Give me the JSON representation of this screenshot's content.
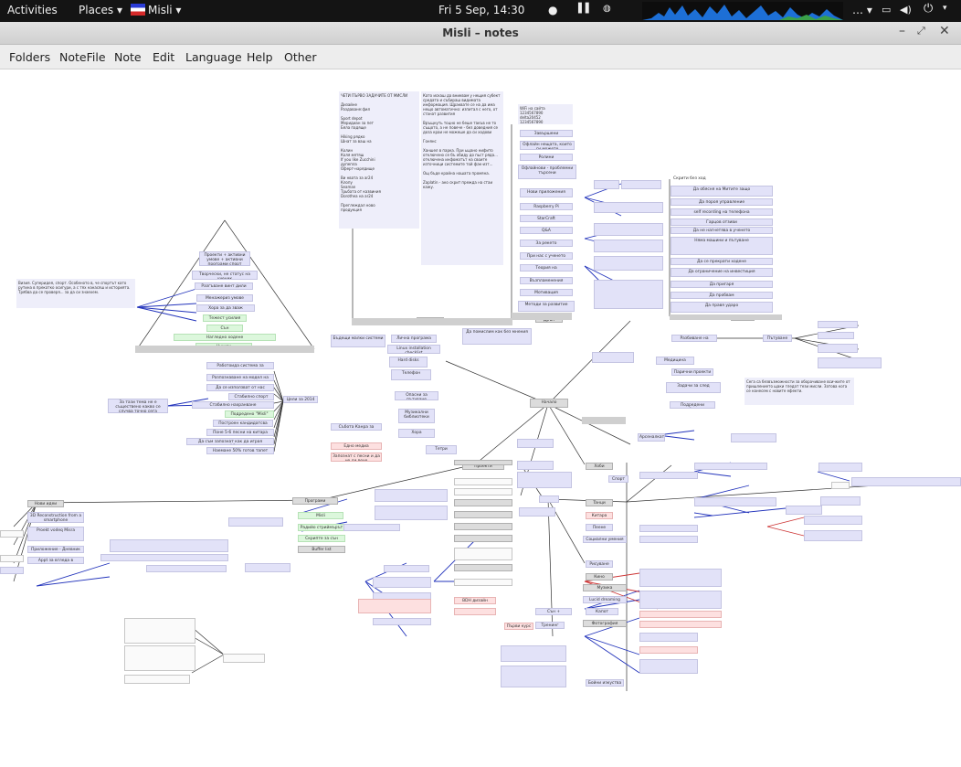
{
  "topbar": {
    "activities": "Activities",
    "places": "Places",
    "app": "Misli",
    "datetime": "Fri  5 Sep, 14:30"
  },
  "window": {
    "title": "Misli – notes"
  },
  "menu": [
    "Folders",
    "NoteFile",
    "Note",
    "Edit",
    "Language",
    "Help",
    "Other"
  ],
  "nodes": [
    {
      "t": "Проекти + активни умове + активни програми спорт",
      "c": "nb"
    },
    {
      "t": "Творчески, не статус на ученик",
      "c": "nb"
    },
    {
      "t": "Разгъване винт дили",
      "c": "nb"
    },
    {
      "t": "Менажериз умове",
      "c": "nb"
    },
    {
      "t": "Хора за да зваж",
      "c": "nb"
    },
    {
      "t": "Тежест усилия",
      "c": "ng"
    },
    {
      "t": "Сън",
      "c": "ng"
    },
    {
      "t": "Нагледно ходене",
      "c": "ng"
    },
    {
      "t": "Нужди",
      "c": "ng"
    },
    {
      "t": "Визия. Суперидея, спорт, съобразяване на живота, работа по шаблон и свободата",
      "c": "nb"
    },
    {
      "t": "Работоида система за разпознаване на думи",
      "c": "nb"
    },
    {
      "t": "Разпознаване на модел на поведение",
      "c": "nb"
    },
    {
      "t": "Да се използват от нас",
      "c": "nb"
    },
    {
      "t": "Стабилно спорт",
      "c": "nb"
    },
    {
      "t": "Стабилно нахранване",
      "c": "nb"
    },
    {
      "t": "Подредено \"Misli\"",
      "c": "ng"
    },
    {
      "t": "Построен кандидатсва",
      "c": "nb"
    },
    {
      "t": "Поне 5-6 песни на китара",
      "c": "nb"
    },
    {
      "t": "Да съм запознат как да играя волейбол",
      "c": "nb"
    },
    {
      "t": "Наемане 50% готов тапет",
      "c": "nb"
    },
    {
      "t": "Цели за 2014",
      "c": "nb"
    },
    {
      "t": "За тази тема не е съществено какво се случва точно сега",
      "c": "nb"
    },
    {
      "t": "Събота Канра за пясък",
      "c": "nb"
    },
    {
      "t": "Едно медиа подкрепяне",
      "c": "nr"
    },
    {
      "t": "Запознат с песни и да не ли вече",
      "c": "nr"
    },
    {
      "t": "Тетри",
      "c": "nb"
    },
    {
      "t": "Хора",
      "c": "nb"
    },
    {
      "t": "Музикални библиотеки",
      "c": "nb"
    },
    {
      "t": "Опасни за пътуване",
      "c": "nb"
    },
    {
      "t": "Телефон",
      "c": "nb"
    },
    {
      "t": "Hard disks",
      "c": "nb"
    },
    {
      "t": "Linux installation checklist",
      "c": "nb"
    },
    {
      "t": "Лична програма",
      "c": "nb"
    },
    {
      "t": "Бъдещи малки системи",
      "c": "nb"
    },
    {
      "t": "Да помислим как без мнения",
      "c": "nb"
    },
    {
      "t": "Начало",
      "c": "nd"
    },
    {
      "t": "Wiki на сайта",
      "c": "nb"
    },
    {
      "t": "Завършени",
      "c": "nb"
    },
    {
      "t": "Офлайн нещата, които си можете",
      "c": "nb"
    },
    {
      "t": "Ролини",
      "c": "nb"
    },
    {
      "t": "Офлайнови - проблемни търсени",
      "c": "nb"
    },
    {
      "t": "Нови приложения",
      "c": "nb"
    },
    {
      "t": "Raspberry Pi",
      "c": "nb"
    },
    {
      "t": "StarCraft",
      "c": "nb"
    },
    {
      "t": "Q&A",
      "c": "nb"
    },
    {
      "t": "За рекето",
      "c": "nb"
    },
    {
      "t": "При нас с ученето",
      "c": "nb"
    },
    {
      "t": "Теория на съглашенията",
      "c": "nb"
    },
    {
      "t": "Възпламенения",
      "c": "nb"
    },
    {
      "t": "Мотивация",
      "c": "nb"
    },
    {
      "t": "Методи за развитие",
      "c": "nb"
    },
    {
      "t": "Дрън",
      "c": "nd"
    },
    {
      "t": "Вид",
      "c": "nd"
    },
    {
      "t": "Скрити без ход",
      "c": "nb"
    },
    {
      "t": "Да обясня на Митите защо",
      "c": "nb"
    },
    {
      "t": "Да пороя управление",
      "c": "nb"
    },
    {
      "t": "self recording на телефона",
      "c": "nb"
    },
    {
      "t": "Гарцов отзиви",
      "c": "nb"
    },
    {
      "t": "Да не нагнетява в ученето",
      "c": "nb"
    },
    {
      "t": "Няма машини и пътуване",
      "c": "nb"
    },
    {
      "t": "Да се прекрати ходене",
      "c": "nb"
    },
    {
      "t": "Да ограничение на инвестиция",
      "c": "nb"
    },
    {
      "t": "Да пригаря",
      "c": "nb"
    },
    {
      "t": "Да пробвам",
      "c": "nb"
    },
    {
      "t": "Да правя ударо",
      "c": "nb"
    },
    {
      "t": "Регулар",
      "c": "nd"
    },
    {
      "t": "Разбиване на статусите",
      "c": "nb"
    },
    {
      "t": "Пътуване",
      "c": "nb"
    },
    {
      "t": "Медицина",
      "c": "nb"
    },
    {
      "t": "Парични проекти",
      "c": "nb"
    },
    {
      "t": "Задачи за след",
      "c": "nb"
    },
    {
      "t": "Подредени събития",
      "c": "nb"
    },
    {
      "t": "Хоби",
      "c": "nd"
    },
    {
      "t": "Арсеналкати",
      "c": "nb"
    },
    {
      "t": "Спорт",
      "c": "nb"
    },
    {
      "t": "Проекти",
      "c": "nd"
    },
    {
      "t": "Програми",
      "c": "nd"
    },
    {
      "t": "Taнци",
      "c": "nd"
    },
    {
      "t": "Китара",
      "c": "nr"
    },
    {
      "t": "Пеене",
      "c": "nb"
    },
    {
      "t": "Социални умения",
      "c": "nb"
    },
    {
      "t": "Рисуване",
      "c": "nb"
    },
    {
      "t": "Кино",
      "c": "nd"
    },
    {
      "t": "Музика",
      "c": "nd"
    },
    {
      "t": "Lucid dreaming",
      "c": "nb"
    },
    {
      "t": "Капот",
      "c": "nb"
    },
    {
      "t": "Фотография",
      "c": "nd"
    },
    {
      "t": "Бойни изкуства",
      "c": "nb"
    },
    {
      "t": "Нови идеи",
      "c": "nd"
    },
    {
      "t": "3D Reconstruction from a smartphone",
      "c": "nb"
    },
    {
      "t": "Proekt vodeq Misra",
      "c": "nb"
    },
    {
      "t": "Приложение - Дневник",
      "c": "nb"
    },
    {
      "t": "Appt за вгледа в текстури",
      "c": "nb"
    },
    {
      "t": "Misli",
      "c": "ng"
    },
    {
      "t": "Радийо стриймърът",
      "c": "ng"
    },
    {
      "t": "Скрипте за сън",
      "c": "ng"
    },
    {
      "t": "Buffer list",
      "c": "nd"
    },
    {
      "t": "Сън + поставяне",
      "c": "nb"
    },
    {
      "t": "Тренинг",
      "c": "nb"
    },
    {
      "t": "Първи курс",
      "c": "nr"
    },
    {
      "t": "BDH дизайн",
      "c": "nr"
    }
  ],
  "dark_nodes": [
    "Проекти",
    "Фотография"
  ]
}
